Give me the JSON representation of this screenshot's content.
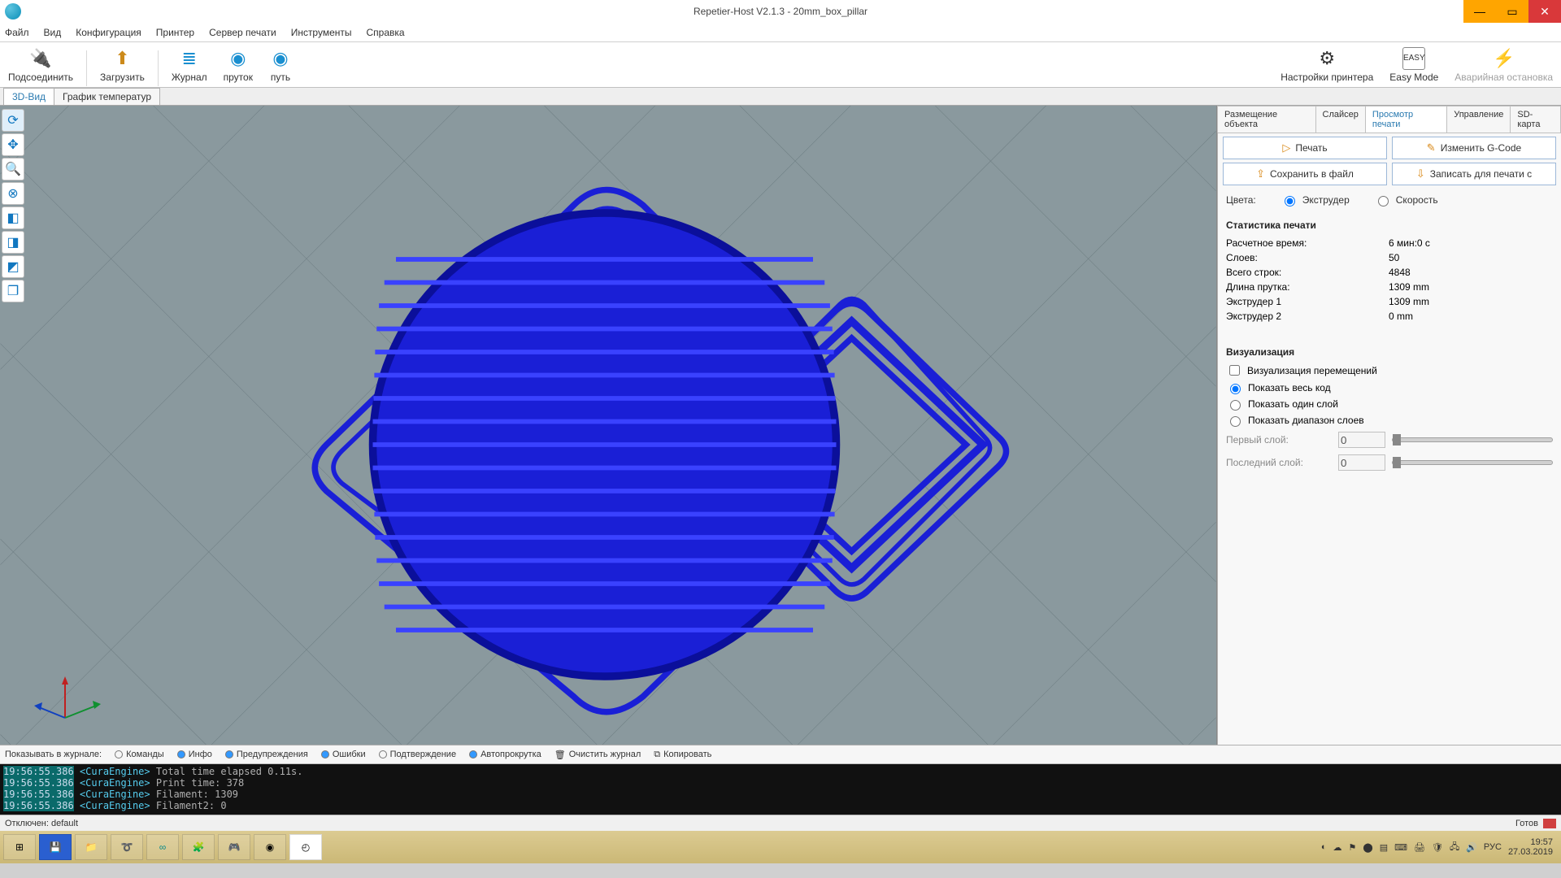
{
  "window": {
    "title": "Repetier-Host V2.1.3 - 20mm_box_pillar"
  },
  "menu": [
    "Файл",
    "Вид",
    "Конфигурация",
    "Принтер",
    "Сервер печати",
    "Инструменты",
    "Справка"
  ],
  "toolbar": {
    "connect": "Подсоединить",
    "load": "Загрузить",
    "log": "Журнал",
    "filament": "пруток",
    "path": "путь",
    "printer_settings": "Настройки принтера",
    "easy": "Easy Mode",
    "estop": "Аварийная остановка"
  },
  "view_tabs": {
    "t3d": "3D-Вид",
    "temp": "График температур"
  },
  "right_tabs": [
    "Размещение объекта",
    "Слайсер",
    "Просмотр печати",
    "Управление",
    "SD-карта"
  ],
  "right_tabs_active": 2,
  "buttons": {
    "print": "Печать",
    "edit": "Изменить G-Code",
    "save": "Сохранить в файл",
    "savesd": "Записать для печати с"
  },
  "colors": {
    "label": "Цвета:",
    "extruder": "Экструдер",
    "speed": "Скорость",
    "selected": "extruder"
  },
  "stats": {
    "header": "Статистика печати",
    "rows": [
      {
        "lab": "Расчетное время:",
        "val": "6 мин:0 с"
      },
      {
        "lab": "Слоев:",
        "val": "50"
      },
      {
        "lab": "Всего строк:",
        "val": "4848"
      },
      {
        "lab": "Длина прутка:",
        "val": "1309 mm"
      },
      {
        "lab": "Экструдер 1",
        "val": "1309 mm"
      },
      {
        "lab": "Экструдер 2",
        "val": "0 mm"
      }
    ]
  },
  "viz": {
    "header": "Визуализация",
    "travel": "Визуализация перемещений",
    "all": "Показать весь код",
    "single": "Показать один слой",
    "range": "Показать диапазон слоев",
    "first": "Первый слой:",
    "last": "Последний слой:",
    "firstv": "0",
    "lastv": "0"
  },
  "logbar": {
    "label": "Показывать в журнале:",
    "cmds": "Команды",
    "info": "Инфо",
    "warn": "Предупреждения",
    "err": "Ошибки",
    "ack": "Подтверждение",
    "auto": "Автопрокрутка",
    "clear": "Очистить журнал",
    "copy": "Копировать"
  },
  "loglines": [
    {
      "ts": "19:56:55.386",
      "src": "<CuraEngine>",
      "msg": "Total time elapsed  0.11s."
    },
    {
      "ts": "19:56:55.386",
      "src": "<CuraEngine>",
      "msg": "Print time: 378"
    },
    {
      "ts": "19:56:55.386",
      "src": "<CuraEngine>",
      "msg": "Filament: 1309"
    },
    {
      "ts": "19:56:55.386",
      "src": "<CuraEngine>",
      "msg": "Filament2: 0"
    }
  ],
  "status": {
    "left": "Отключен: default",
    "right": "Готов"
  },
  "os": {
    "lang": "РУС",
    "time": "19:57",
    "date": "27.03.2019"
  }
}
